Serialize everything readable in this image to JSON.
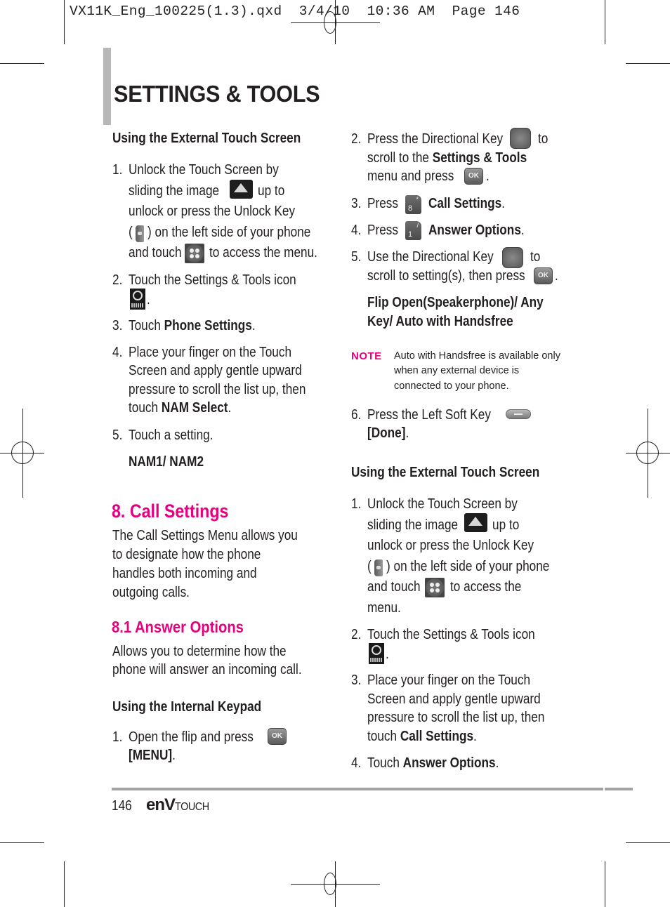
{
  "slug": "VX11K_Eng_100225(1.3).qxd  3/4/10  10:36 AM  Page 146",
  "header": {
    "title": "SETTINGS & TOOLS"
  },
  "left": {
    "ext_heading": "Using the External Touch Screen",
    "step1": {
      "num": "1.",
      "l1": "Unlock the Touch Screen by",
      "l2a": "sliding the image",
      "l2b": "up to",
      "l3": "unlock or press the Unlock Key",
      "l4a": "(",
      "l4b": ") on the left side of your phone",
      "l5a": "and touch",
      "l5b": "to access the menu."
    },
    "step2": {
      "num": "2.",
      "l1": "Touch the Settings & Tools icon",
      "l2": "."
    },
    "step3": {
      "num": "3.",
      "pre": "Touch ",
      "bold": "Phone Settings",
      "post": "."
    },
    "step4": {
      "num": "4.",
      "l1": "Place your finger on the Touch",
      "l2": "Screen and apply gentle upward",
      "l3": "pressure to scroll the list up, then",
      "l4pre": "touch ",
      "l4bold": "NAM Select",
      "l4post": "."
    },
    "step5": {
      "num": "5.",
      "l1": "Touch a setting."
    },
    "options": "NAM1/ NAM2",
    "section_title": "8. Call Settings",
    "section_body": [
      "The Call Settings Menu allows you",
      "to designate how the phone",
      "handles both incoming and",
      "outgoing calls."
    ],
    "subsection_title": "8.1 Answer Options",
    "subsection_body": [
      "Allows you to determine how the",
      "phone will answer an incoming call."
    ],
    "int_heading": "Using the Internal Keypad",
    "int_step1": {
      "num": "1.",
      "l1": "Open the flip and press",
      "l2bold": "[MENU]",
      "l2post": "."
    }
  },
  "right": {
    "step2": {
      "num": "2.",
      "l1a": "Press the Directional Key",
      "l1b": "to",
      "l2pre": "scroll to the ",
      "l2bold": "Settings & Tools",
      "l3a": "menu and press",
      "l3b": "."
    },
    "step3": {
      "num": "3.",
      "pre": "Press",
      "bold": "Call Settings",
      "post": "."
    },
    "step4": {
      "num": "4.",
      "pre": "Press",
      "bold": "Answer Options",
      "post": "."
    },
    "step5": {
      "num": "5.",
      "l1a": "Use the Directional Key",
      "l1b": "to",
      "l2a": "scroll to setting(s), then press",
      "l2b": "."
    },
    "options": [
      "Flip Open(Speakerphone)/ Any",
      "Key/ Auto with Handsfree"
    ],
    "note": {
      "label": "NOTE",
      "lines": [
        "Auto with Handsfree is available only",
        "when any external device is",
        "connected to your phone."
      ]
    },
    "step6": {
      "num": "6.",
      "l1": "Press the Left Soft Key",
      "l2bold": "[Done]",
      "l2post": "."
    },
    "ext_heading": "Using the External Touch Screen",
    "ext_step1": {
      "num": "1.",
      "l1": "Unlock the Touch Screen by",
      "l2a": "sliding the image",
      "l2b": "up to",
      "l3": "unlock or press the Unlock Key",
      "l4a": "(",
      "l4b": ") on the left side of your phone",
      "l5a": "and touch",
      "l5b": "to access the",
      "l6": "menu."
    },
    "ext_step2": {
      "num": "2.",
      "l1": "Touch the Settings & Tools icon",
      "l2": "."
    },
    "ext_step3": {
      "num": "3.",
      "l1": "Place your finger on the Touch",
      "l2": "Screen and apply gentle upward",
      "l3": "pressure to scroll the list up, then",
      "l4pre": "touch ",
      "l4bold": "Call Settings",
      "l4post": "."
    },
    "ext_step4": {
      "num": "4.",
      "pre": "Touch ",
      "bold": "Answer Options",
      "post": "."
    }
  },
  "icons": {
    "ok_label": "OK",
    "key8_num": "8",
    "key8_sym": "*",
    "key1_num": "1",
    "key1_sym": "/"
  },
  "footer": {
    "page_number": "146",
    "brand_env": "enV",
    "brand_touch": "TOUCH"
  },
  "colors": {
    "accent": "#e6007e",
    "text": "#231f20",
    "bar": "#b8b8b8",
    "rule": "#a3a3a3"
  }
}
